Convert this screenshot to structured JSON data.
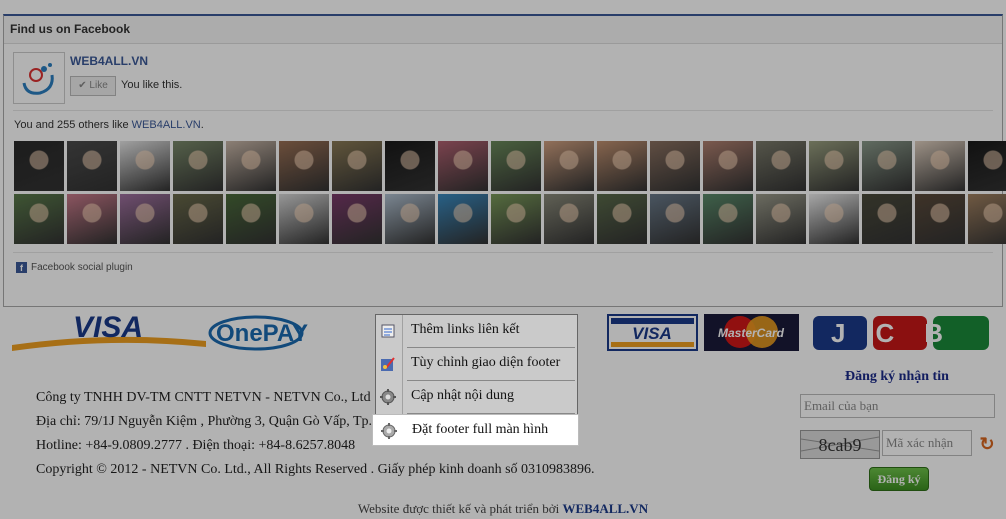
{
  "facebook": {
    "header": "Find us on Facebook",
    "page_name": "WEB4ALL.VN",
    "like_button": "Like",
    "you_like": "You like this.",
    "count_prefix": "You and 255 others like ",
    "count_link": "WEB4ALL.VN",
    "count_suffix": ".",
    "plugin_label": "Facebook social plugin",
    "fan_colors": [
      "#2a2a2a",
      "#4b4b4b",
      "#e6e6e6",
      "#7a8a6a",
      "#c9b7a8",
      "#9a7055",
      "#8a7a55",
      "#1a1a1a",
      "#b06070",
      "#6a8a5a",
      "#d0a080",
      "#c09070",
      "#8a7060",
      "#b08070",
      "#7a7a6a",
      "#9aa080",
      "#8a9a8a",
      "#e0d0c0",
      "#1a1a1a",
      "#5a7a4a",
      "#c87a8a",
      "#a070a0",
      "#6a6a4a",
      "#4a6a3a",
      "#d8d8d8",
      "#7a3a6a",
      "#b0c0d0",
      "#3a8ac0",
      "#7a9a5a",
      "#8a8a7a",
      "#5a6a4a",
      "#6a7a8a",
      "#5a8a6a",
      "#9a9a8a",
      "#eeeeee",
      "#4a4a3a",
      "#5a4a3a",
      "#a08060"
    ]
  },
  "payment": {
    "visa_big": "VISA",
    "onepay": "OnePAY",
    "visa_card": "VISA",
    "mastercard": "MasterCard",
    "jcb": "JCB"
  },
  "company": {
    "line1": "Công ty TNHH DV-TM CNTT NETVN - NETVN Co., Ltd",
    "line2": "Địa chỉ: 79/1J Nguyễn Kiệm , Phường 3, Quận Gò Vấp, Tp.",
    "line3": "Hotline: +84-9.0809.2777 . Điện thoại: +84-8.6257.8048",
    "line4": "Copyright © 2012 - NETVN Co. Ltd., All Rights Reserved . Giấy phép kinh doanh số 0310983896."
  },
  "newsletter": {
    "title": "Đăng ký nhận tin",
    "email_placeholder": "Email của bạn",
    "captcha_text": "8cab9",
    "captcha_placeholder": "Mã xác nhận",
    "submit_label": "Đăng ký"
  },
  "credit": {
    "prefix": "Website được thiết kế và phát triển bởi ",
    "link": "WEB4ALL.VN"
  },
  "context_menu": {
    "items": [
      {
        "label": "Thêm links liên kết",
        "icon": "link-list-icon"
      },
      {
        "label": "Tùy chỉnh giao diện footer",
        "icon": "customize-icon"
      },
      {
        "label": "Cập nhật nội dung",
        "icon": "gear-icon"
      },
      {
        "label": "Đặt footer full màn hình",
        "icon": "gear-icon"
      }
    ],
    "highlighted_index": 3
  }
}
